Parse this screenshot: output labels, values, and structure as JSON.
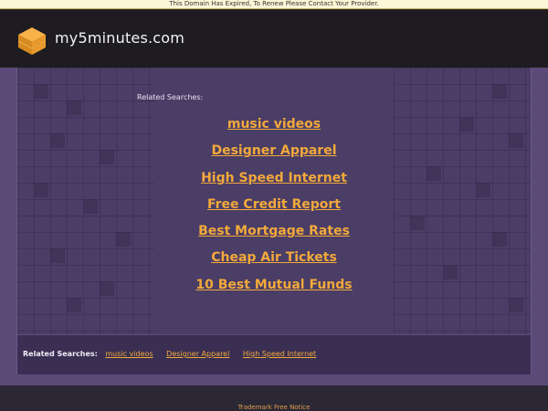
{
  "notice": "This Domain Has Expired, To Renew Please Contact Your Provider.",
  "header": {
    "site_name": "my5minutes.com",
    "logo_icon": "stacked-layers-icon"
  },
  "main": {
    "related_label": "Related Searches:",
    "links": [
      "music videos",
      "Designer Apparel",
      "High Speed Internet",
      "Free Credit Report",
      "Best Mortgage Rates",
      "Cheap Air Tickets",
      "10 Best Mutual Funds"
    ]
  },
  "footer_strip": {
    "label": "Related Searches:",
    "links": [
      "music videos",
      "Designer Apparel",
      "High Speed Internet"
    ]
  },
  "bottom": {
    "trademark": "Trademark Free Notice"
  },
  "colors": {
    "accent": "#f2a93b",
    "header_bg": "#1e1c20",
    "panel_bg": "#4a3d66"
  }
}
